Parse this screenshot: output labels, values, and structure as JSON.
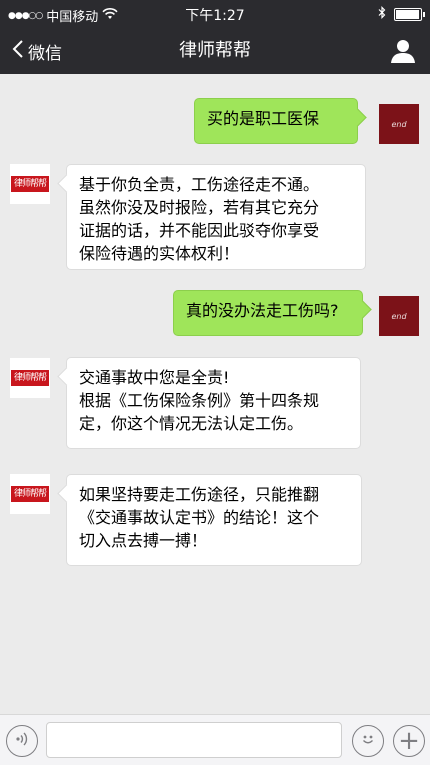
{
  "status_bar": {
    "signal_dots": "●●●○○",
    "carrier": "中国移动",
    "time": "下午1:27"
  },
  "nav": {
    "back_label": "微信",
    "title": "律师帮帮"
  },
  "avatars": {
    "user_text": "end",
    "lawyer_logo_text": "律师帮帮"
  },
  "messages": [
    {
      "side": "right",
      "lines": [
        "买的是职工医保"
      ]
    },
    {
      "side": "left",
      "lines": [
        "基于你负全责，工伤途径走不通。",
        "虽然你没及时报险，若有其它充分",
        "证据的话，并不能因此驳夺你享受",
        "保险待遇的实体权利！"
      ]
    },
    {
      "side": "right",
      "lines": [
        "真的没办法走工伤吗?"
      ]
    },
    {
      "side": "left",
      "lines": [
        "交通事故中您是全责!",
        "根据《工伤保险条例》第十四条规",
        "定，你这个情况无法认定工伤。"
      ]
    },
    {
      "side": "left",
      "lines": [
        "如果坚持要走工伤途径，只能推翻",
        "《交通事故认定书》的结论！这个",
        "切入点去搏一搏！"
      ]
    }
  ],
  "input_bar": {
    "plus_label": "+"
  }
}
